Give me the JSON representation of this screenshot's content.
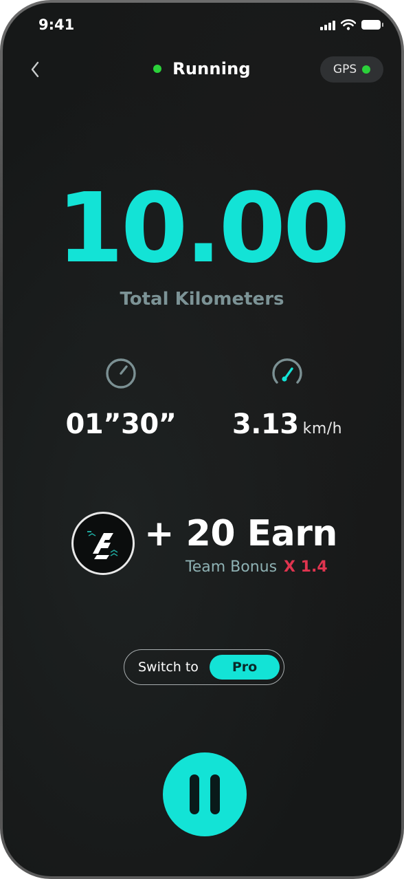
{
  "status_bar": {
    "time": "9:41"
  },
  "nav": {
    "title": "Running",
    "gps_label": "GPS"
  },
  "distance": {
    "value": "10.00",
    "label": "Total Kilometers"
  },
  "stats": {
    "time": {
      "value": "01”30”",
      "icon": "stopwatch-icon"
    },
    "speed": {
      "value": "3.13",
      "unit": "km/h",
      "icon": "speedometer-icon"
    }
  },
  "earn": {
    "amount_text": "+ 20 Earn",
    "bonus_label": "Team Bonus",
    "bonus_multiplier": "X 1.4"
  },
  "switch": {
    "label": "Switch to",
    "option": "Pro"
  },
  "controls": {
    "pause_icon": "pause-icon"
  },
  "colors": {
    "accent": "#13e3d6",
    "status_green": "#2bd13a",
    "bonus_red": "#e0344f",
    "background": "#161818"
  }
}
